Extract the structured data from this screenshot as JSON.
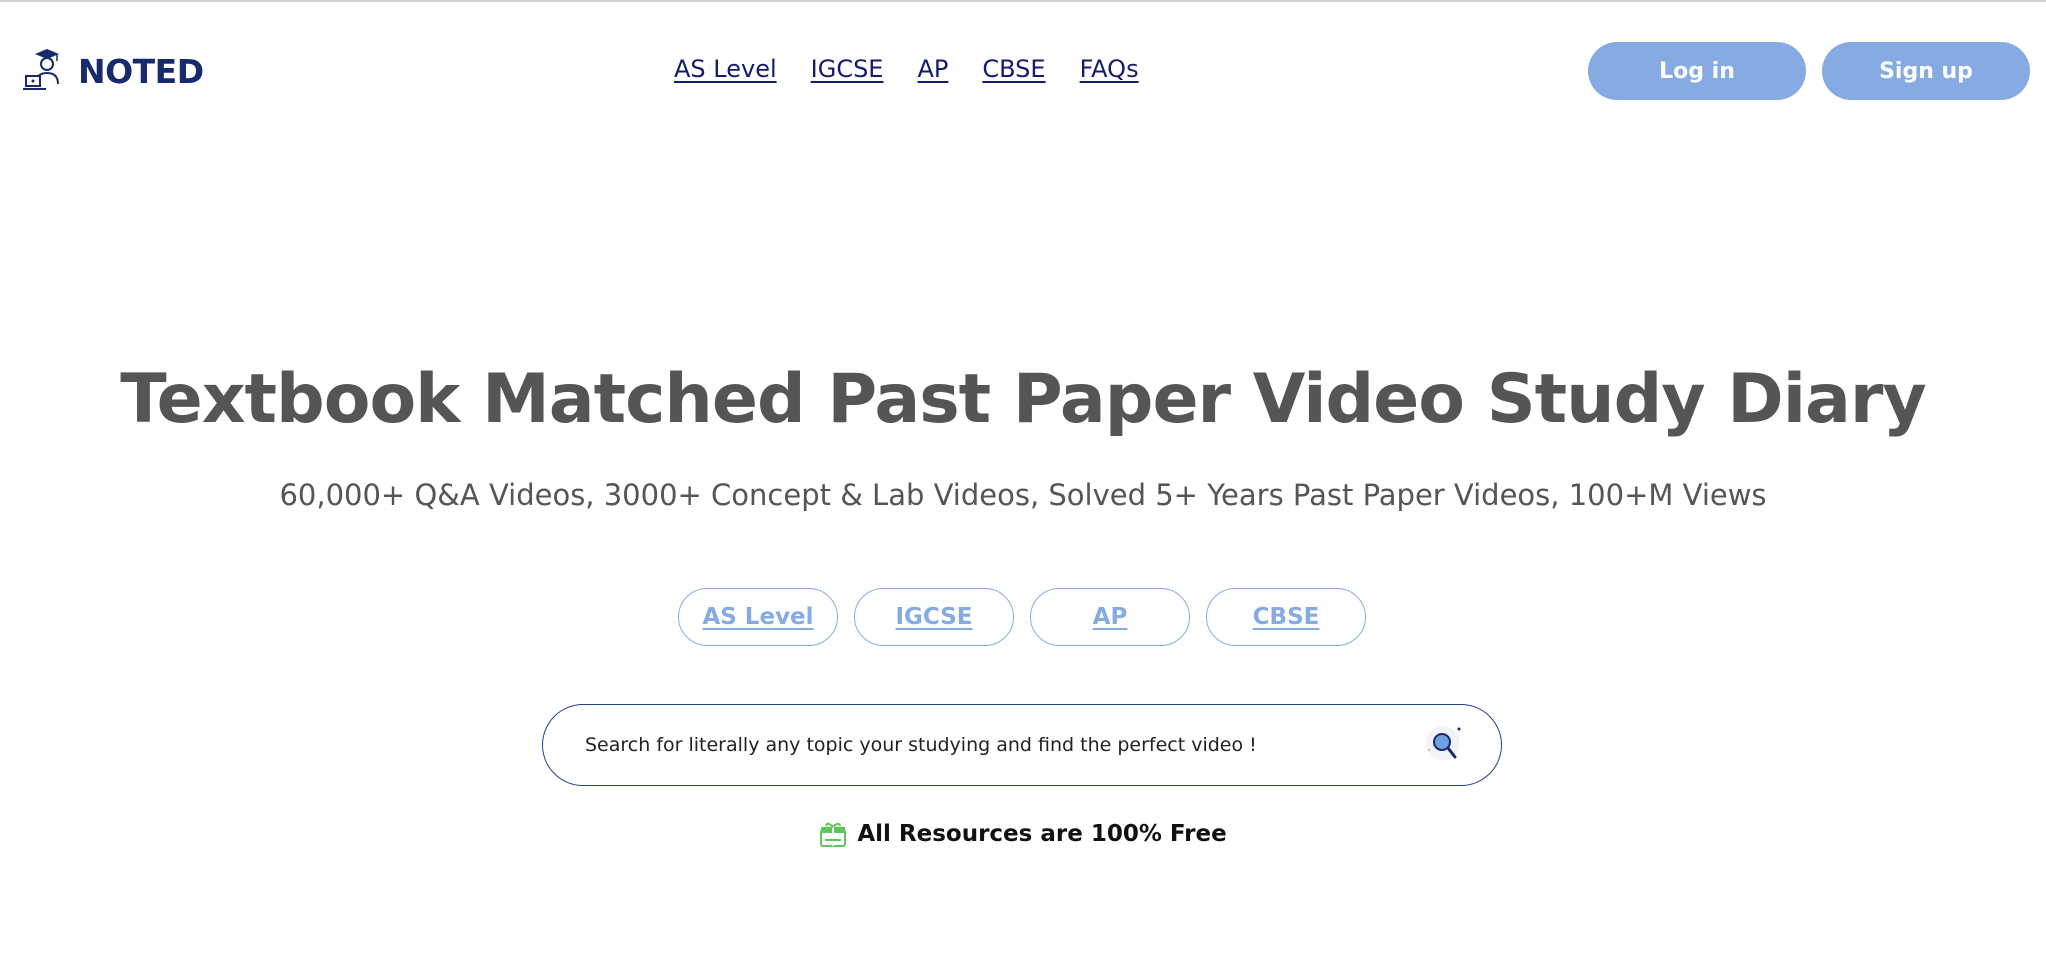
{
  "header": {
    "logo_text": "NOTED",
    "nav": [
      {
        "label": "AS Level"
      },
      {
        "label": "IGCSE"
      },
      {
        "label": "AP"
      },
      {
        "label": "CBSE"
      },
      {
        "label": "FAQs"
      }
    ],
    "login_label": "Log in",
    "signup_label": "Sign up"
  },
  "hero": {
    "title": "Textbook Matched Past Paper Video Study Diary",
    "subtitle": "60,000+ Q&A Videos, 3000+ Concept & Lab Videos, Solved 5+ Years Past Paper Videos, 100+M Views",
    "chips": [
      {
        "label": "AS Level"
      },
      {
        "label": "IGCSE"
      },
      {
        "label": "AP"
      },
      {
        "label": "CBSE"
      }
    ],
    "search": {
      "placeholder": "Search for literally any topic your studying and find the perfect video !",
      "value": ""
    },
    "free_text": "All Resources are 100% Free"
  },
  "colors": {
    "brand_navy": "#172a6b",
    "nav_link": "#141a6d",
    "accent_blue": "#86abe3",
    "heading_gray": "#555555",
    "gift_green": "#5cc75a"
  },
  "icons": {
    "logo": "graduate-with-laptop-icon",
    "search": "magnifier-icon",
    "free": "gift-icon"
  }
}
